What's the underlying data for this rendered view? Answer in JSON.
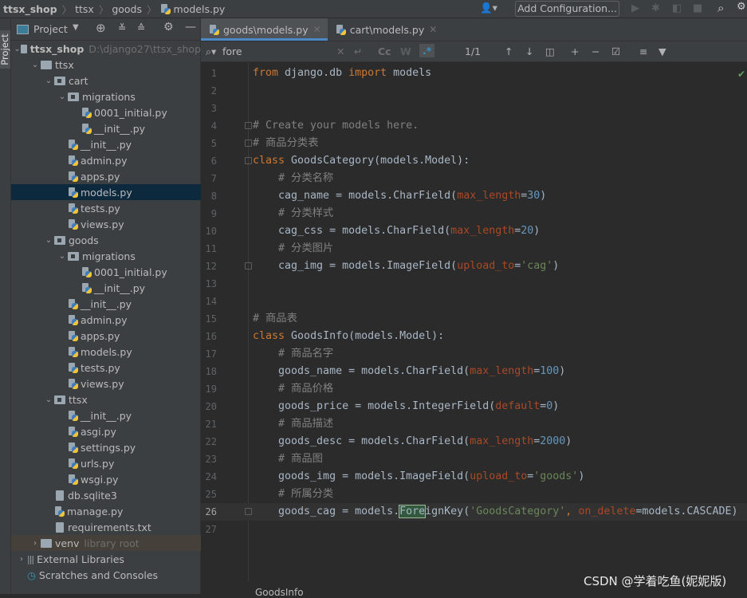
{
  "navbar": {
    "crumbs": [
      "ttsx_shop",
      "ttsx",
      "goods",
      "models.py"
    ],
    "add_config": "Add Configuration..."
  },
  "stripe": {
    "label": "Project"
  },
  "panel": {
    "title": "Project",
    "tree": [
      {
        "label": "ttsx_shop",
        "level": 0,
        "type": "folder",
        "chev": "open",
        "hint": "D:\\django27\\ttsx_shop",
        "bold": true
      },
      {
        "label": "ttsx",
        "level": 1,
        "type": "folder",
        "chev": "open"
      },
      {
        "label": "cart",
        "level": 2,
        "type": "pkg",
        "chev": "open"
      },
      {
        "label": "migrations",
        "level": 3,
        "type": "pkg",
        "chev": "open"
      },
      {
        "label": "0001_initial.py",
        "level": 4,
        "type": "py"
      },
      {
        "label": "__init__.py",
        "level": 4,
        "type": "py"
      },
      {
        "label": "__init__.py",
        "level": 3,
        "type": "py"
      },
      {
        "label": "admin.py",
        "level": 3,
        "type": "py"
      },
      {
        "label": "apps.py",
        "level": 3,
        "type": "py"
      },
      {
        "label": "models.py",
        "level": 3,
        "type": "py",
        "selected": true
      },
      {
        "label": "tests.py",
        "level": 3,
        "type": "py"
      },
      {
        "label": "views.py",
        "level": 3,
        "type": "py"
      },
      {
        "label": "goods",
        "level": 2,
        "type": "pkg",
        "chev": "open"
      },
      {
        "label": "migrations",
        "level": 3,
        "type": "pkg",
        "chev": "open"
      },
      {
        "label": "0001_initial.py",
        "level": 4,
        "type": "py"
      },
      {
        "label": "__init__.py",
        "level": 4,
        "type": "py"
      },
      {
        "label": "__init__.py",
        "level": 3,
        "type": "py"
      },
      {
        "label": "admin.py",
        "level": 3,
        "type": "py"
      },
      {
        "label": "apps.py",
        "level": 3,
        "type": "py"
      },
      {
        "label": "models.py",
        "level": 3,
        "type": "py"
      },
      {
        "label": "tests.py",
        "level": 3,
        "type": "py"
      },
      {
        "label": "views.py",
        "level": 3,
        "type": "py"
      },
      {
        "label": "ttsx",
        "level": 2,
        "type": "pkg",
        "chev": "open"
      },
      {
        "label": "__init__.py",
        "level": 3,
        "type": "py"
      },
      {
        "label": "asgi.py",
        "level": 3,
        "type": "py"
      },
      {
        "label": "settings.py",
        "level": 3,
        "type": "py"
      },
      {
        "label": "urls.py",
        "level": 3,
        "type": "py"
      },
      {
        "label": "wsgi.py",
        "level": 3,
        "type": "py"
      },
      {
        "label": "db.sqlite3",
        "level": 2,
        "type": "file"
      },
      {
        "label": "manage.py",
        "level": 2,
        "type": "py"
      },
      {
        "label": "requirements.txt",
        "level": 2,
        "type": "file"
      },
      {
        "label": "venv",
        "level": 1,
        "type": "folder",
        "chev": "closed",
        "hint": "library root",
        "lib": true
      },
      {
        "label": "External Libraries",
        "level": 0,
        "type": "lib",
        "chev": "closed"
      },
      {
        "label": "Scratches and Consoles",
        "level": 0,
        "type": "scratch"
      }
    ]
  },
  "tabs": [
    {
      "label": "goods\\models.py",
      "active": true
    },
    {
      "label": "cart\\models.py",
      "active": false
    }
  ],
  "search": {
    "query": "fore",
    "match_case": "Cc",
    "words": "W",
    "regex": ".*",
    "count": "1/1"
  },
  "editor": {
    "current_line": 26,
    "lines": [
      [
        [
          "from ",
          "kw"
        ],
        [
          "django.db ",
          "id"
        ],
        [
          "import ",
          "kw"
        ],
        [
          "models",
          "id"
        ]
      ],
      [],
      [],
      [
        [
          "# Create your models here.",
          "cm"
        ]
      ],
      [
        [
          "# 商品分类表",
          "cm"
        ]
      ],
      [
        [
          "class ",
          "kw"
        ],
        [
          "GoodsCategory(models.Model):",
          "id"
        ]
      ],
      [
        [
          "    # 分类名称",
          "cm"
        ]
      ],
      [
        [
          "    cag_name = models.CharField(",
          "id"
        ],
        [
          "max_length",
          "kwa"
        ],
        [
          "=",
          "id"
        ],
        [
          "30",
          "num"
        ],
        [
          ")",
          "id"
        ]
      ],
      [
        [
          "    # 分类样式",
          "cm"
        ]
      ],
      [
        [
          "    cag_css = models.CharField(",
          "id"
        ],
        [
          "max_length",
          "kwa"
        ],
        [
          "=",
          "id"
        ],
        [
          "20",
          "num"
        ],
        [
          ")",
          "id"
        ]
      ],
      [
        [
          "    # 分类图片",
          "cm"
        ]
      ],
      [
        [
          "    cag_img = models.ImageField(",
          "id"
        ],
        [
          "upload_to",
          "kwa"
        ],
        [
          "=",
          "id"
        ],
        [
          "'cag'",
          "st"
        ],
        [
          ")",
          "id"
        ]
      ],
      [],
      [],
      [
        [
          "# 商品表",
          "cm"
        ]
      ],
      [
        [
          "class ",
          "kw"
        ],
        [
          "GoodsInfo(models.Model):",
          "id"
        ]
      ],
      [
        [
          "    # 商品名字",
          "cm"
        ]
      ],
      [
        [
          "    goods_name = models.CharField(",
          "id"
        ],
        [
          "max_length",
          "kwa"
        ],
        [
          "=",
          "id"
        ],
        [
          "100",
          "num"
        ],
        [
          ")",
          "id"
        ]
      ],
      [
        [
          "    # 商品价格",
          "cm"
        ]
      ],
      [
        [
          "    goods_price = models.IntegerField(",
          "id"
        ],
        [
          "default",
          "kwa"
        ],
        [
          "=",
          "id"
        ],
        [
          "0",
          "num"
        ],
        [
          ")",
          "id"
        ]
      ],
      [
        [
          "    # 商品描述",
          "cm"
        ]
      ],
      [
        [
          "    goods_desc = models.CharField(",
          "id"
        ],
        [
          "max_length",
          "kwa"
        ],
        [
          "=",
          "id"
        ],
        [
          "2000",
          "num"
        ],
        [
          ")",
          "id"
        ]
      ],
      [
        [
          "    # 商品图",
          "cm"
        ]
      ],
      [
        [
          "    goods_img = models.ImageField(",
          "id"
        ],
        [
          "upload_to",
          "kwa"
        ],
        [
          "=",
          "id"
        ],
        [
          "'goods'",
          "st"
        ],
        [
          ")",
          "id"
        ]
      ],
      [
        [
          "    # 所属分类",
          "cm"
        ]
      ],
      [
        [
          "    goods_cag = models.",
          "id"
        ],
        [
          "Fore",
          "id hl"
        ],
        [
          "ignKey(",
          "id"
        ],
        [
          "'GoodsCategory'",
          "st"
        ],
        [
          ", ",
          "kw"
        ],
        [
          "on_delete",
          "kwa"
        ],
        [
          "=models.CASCADE)",
          "id"
        ]
      ],
      []
    ],
    "folds": [
      4,
      5,
      6,
      12,
      26
    ]
  },
  "breadcrumb_bottom": "GoodsInfo",
  "watermark": "CSDN @学着吃鱼(妮妮版)"
}
